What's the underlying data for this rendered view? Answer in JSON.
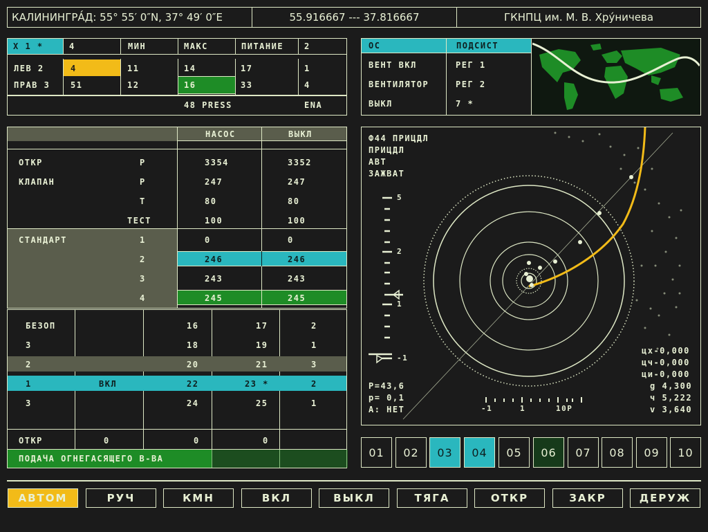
{
  "header": {
    "location": "КАЛИНИНГРА́Д: 55° 55′ 0″N, 37° 49′ 0″E",
    "coords": "55.916667 --- 37.816667",
    "org": "ГКНПЦ им. М. В. Хру́ничева"
  },
  "top_table": {
    "h1": "X 1 *",
    "h2": "4",
    "h3": "МИН",
    "h4": "МАКС",
    "h5": "ПИТАНИЕ",
    "h6": "2",
    "r1": [
      "ЛЕВ 2",
      "4",
      "11",
      "14",
      "17",
      "1"
    ],
    "r2": [
      "ПРАВ 3",
      "51",
      "12",
      "16",
      "33",
      "4"
    ],
    "footer_a": "48 PRESS",
    "footer_b": "ENA"
  },
  "os_panel": {
    "h1": "ОС",
    "h2": "ПОДСИСТ",
    "rows": [
      [
        "ВЕНТ ВКЛ",
        "РЕГ 1"
      ],
      [
        "ВЕНТИЛЯТОР",
        "РЕГ 2"
      ],
      [
        "ВЫКЛ",
        "7 *"
      ]
    ]
  },
  "pump_table": {
    "col1": "НАСОС",
    "col2": "ВЫКЛ",
    "r_otkr": [
      "ОТКР",
      "P",
      "3354",
      "3352"
    ],
    "r_klapan": [
      "КЛАПАН",
      "P",
      "247",
      "247"
    ],
    "r_t": [
      "T",
      "80",
      "80"
    ],
    "r_test": [
      "ТЕСТ",
      "100",
      "100"
    ],
    "r_std": [
      "СТАНДАРТ",
      "1",
      "0",
      "0"
    ],
    "r2": [
      "2",
      "246",
      "246"
    ],
    "r3": [
      "3",
      "243",
      "243"
    ],
    "r4": [
      "4",
      "245",
      "245"
    ]
  },
  "safety_table": {
    "rows": [
      [
        "БЕЗОП",
        "",
        "16",
        "17",
        "2"
      ],
      [
        "3",
        "",
        "18",
        "19",
        "1"
      ],
      [
        "2",
        "",
        "20",
        "21",
        "3"
      ],
      [
        "1",
        "ВКЛ",
        "22",
        "23 *",
        "2"
      ],
      [
        "3",
        "",
        "24",
        "25",
        "1"
      ]
    ],
    "otkr": [
      "ОТКР",
      "0",
      "0",
      "0"
    ],
    "feed_label": "ПОДАЧА ОГНЕГАСЯЩЕГО В-ВА"
  },
  "scope": {
    "l1": "Ф44 ПРИЦДЛ",
    "l2": "ПРИЦДЛ",
    "l3": "АВТ",
    "l4": "ЗАЖВАТ",
    "scale_5": "5",
    "scale_2": "2",
    "scale_1": "1",
    "scale_m1": "-1",
    "p_big": "P=43,6",
    "p_small": "p= 0,1",
    "a_status": "A: НЕТ",
    "ruler_a": "-1",
    "ruler_b": "1",
    "ruler_c": "10P",
    "r1": "цх-0,000",
    "r2": "цч-0,000",
    "r3": "ци-0,000",
    "r4": "g 4,300",
    "r5": "ч 5,222",
    "r6": "v 3,640"
  },
  "channels": [
    "01",
    "02",
    "03",
    "04",
    "05",
    "06",
    "07",
    "08",
    "09",
    "10"
  ],
  "buttons": [
    "АВТОМ",
    "РУЧ",
    "КМН",
    "ВКЛ",
    "ВЫКЛ",
    "ТЯГА",
    "ОТКР",
    "ЗАКР",
    "ДЕРУЖ"
  ],
  "colors": {
    "teal": "#2ab7be",
    "green": "#1e8c26",
    "amber": "#f2bb18",
    "orbit": "#f2bb18",
    "line": "#dfe9c6",
    "map_land": "#1e8c26",
    "map_sea": "#111a11"
  }
}
